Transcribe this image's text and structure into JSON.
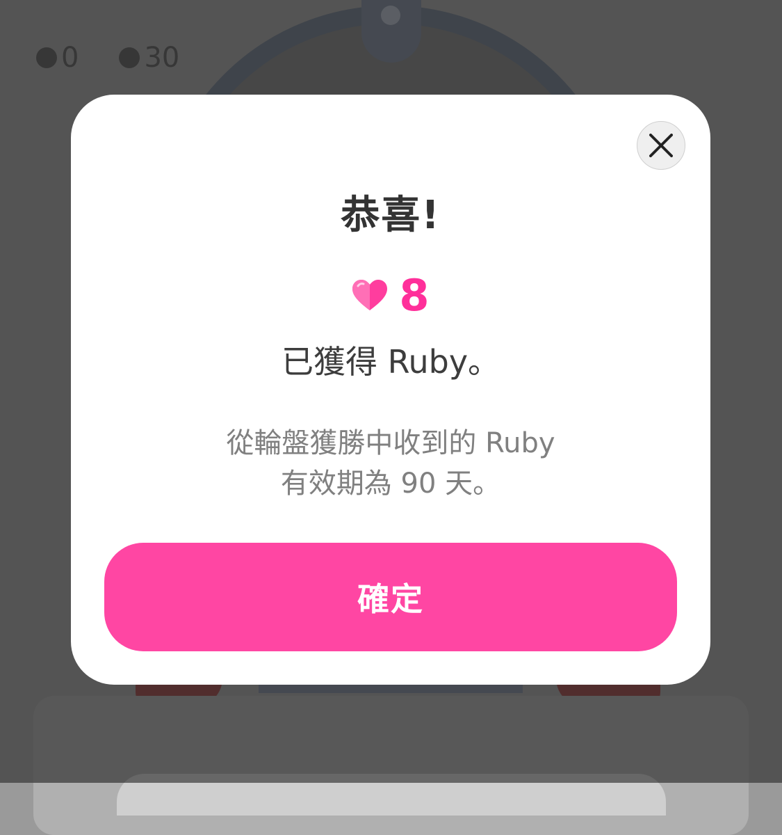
{
  "background": {
    "stat_one_value": "0",
    "stat_two_value": "30"
  },
  "modal": {
    "title": "恭喜!",
    "reward_amount": "8",
    "reward_icon": "ruby-heart-icon",
    "obtained_text": "已獲得 Ruby。",
    "notice_line1": "從輪盤獲勝中收到的 Ruby",
    "notice_line2": "有效期為 90 天。",
    "confirm_label": "確定",
    "close_icon": "close-icon"
  },
  "colors": {
    "accent": "#ff46a3",
    "ruby": "#ff2f9a",
    "title": "#333333",
    "body_text": "#3d3d3d",
    "muted_text": "#808080"
  }
}
